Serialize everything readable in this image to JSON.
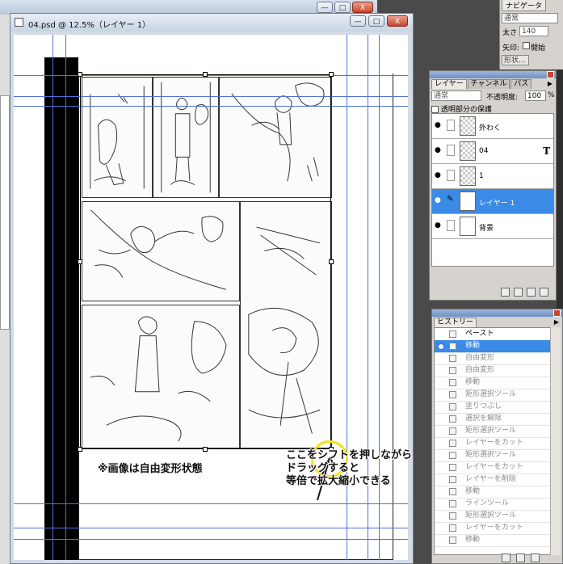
{
  "document": {
    "title": "04.psd @ 12.5%（レイヤー 1）",
    "free_transform_note": "※画像は自由変形状態",
    "instruction_lines": [
      "ここをシフトを押しながら",
      "ドラッグすると",
      "等倍で拡大縮小できる"
    ]
  },
  "window_buttons": {
    "minimize": "—",
    "maximize": "□",
    "close": "X"
  },
  "navigator": {
    "tab": "ナビゲータ",
    "mode": "通常",
    "thickness_label": "太さ",
    "thickness_value": "140",
    "arrow_label": "矢印:",
    "arrow_option": "開始",
    "shape_label": "形状..."
  },
  "layers": {
    "tabs": [
      "レイヤー",
      "チャンネル",
      "パス"
    ],
    "blend_mode": "通常",
    "opacity_label": "不透明度:",
    "opacity_value": "100",
    "opacity_unit": "%",
    "lock_label": "透明部分の保護",
    "items": [
      {
        "name": "外わく",
        "type": "raster",
        "selected": false
      },
      {
        "name": "04",
        "type": "text",
        "selected": false
      },
      {
        "name": "1",
        "type": "raster",
        "selected": false
      },
      {
        "name": "レイヤー 1",
        "type": "raster",
        "selected": true
      },
      {
        "name": "背景",
        "type": "background",
        "selected": false
      }
    ],
    "text_layer_glyph": "T"
  },
  "history": {
    "tab": "ヒストリー",
    "items": [
      {
        "label": "ペースト",
        "state": "normal"
      },
      {
        "label": "移動",
        "state": "active"
      },
      {
        "label": "自由変形",
        "state": "dim"
      },
      {
        "label": "自由変形",
        "state": "dim"
      },
      {
        "label": "移動",
        "state": "dim"
      },
      {
        "label": "矩形選択ツール",
        "state": "dim"
      },
      {
        "label": "塗りつぶし",
        "state": "dim"
      },
      {
        "label": "選択を解除",
        "state": "dim"
      },
      {
        "label": "矩形選択ツール",
        "state": "dim"
      },
      {
        "label": "レイヤーをカット",
        "state": "dim"
      },
      {
        "label": "矩形選択ツール",
        "state": "dim"
      },
      {
        "label": "レイヤーをカット",
        "state": "dim"
      },
      {
        "label": "レイヤーを削除",
        "state": "dim"
      },
      {
        "label": "移動",
        "state": "dim"
      },
      {
        "label": "ラインツール",
        "state": "dim"
      },
      {
        "label": "矩形選択ツール",
        "state": "dim"
      },
      {
        "label": "レイヤーをカット",
        "state": "dim"
      },
      {
        "label": "移動",
        "state": "dim"
      }
    ]
  },
  "colors": {
    "selection_blue": "#3a8ae6",
    "guide_blue": "#4e73d6",
    "highlight_yellow": "#f2e21a"
  }
}
